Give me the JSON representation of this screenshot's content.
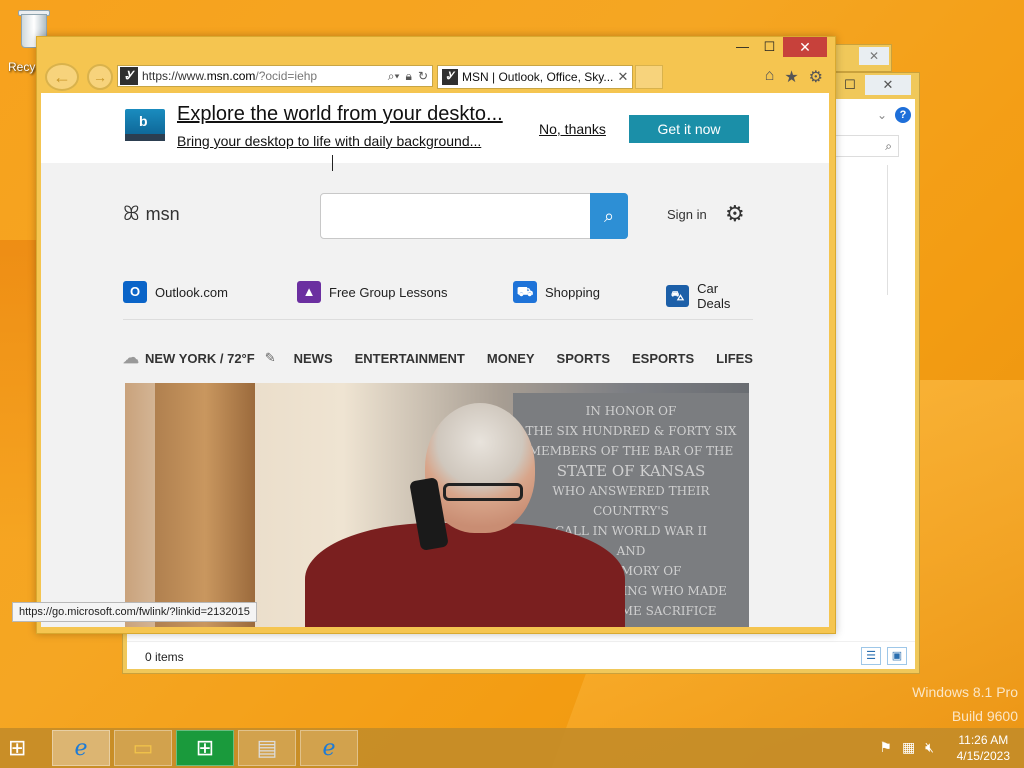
{
  "desktop": {
    "recycle_label": "Recyc",
    "watermark_line1": "Windows 8.1 Pro",
    "watermark_line2": "Build 9600"
  },
  "explorer": {
    "status_count": "0 items",
    "help_icon": "?",
    "search_icon": "search-icon"
  },
  "ie": {
    "window_buttons": {
      "minimize": "—",
      "maximize": "☐",
      "close": "✕"
    },
    "address": {
      "url_prefix": "https://www.",
      "url_domain": "msn.com",
      "url_suffix": "/?ocid=iehp"
    },
    "tab": {
      "title": "MSN | Outlook, Office, Sky...",
      "close": "✕"
    },
    "status_url": "https://go.microsoft.com/fwlink/?linkid=2132015"
  },
  "page": {
    "banner": {
      "headline": "Explore the world from your deskto...",
      "subtext": "Bring your desktop to life with daily background...",
      "no_thanks": "No, thanks",
      "get_it": "Get it now"
    },
    "logo_text": "msn",
    "sign_in": "Sign in",
    "quick_links": [
      {
        "label": "Outlook.com",
        "icon": "outlook-icon",
        "color": "#0a64c8"
      },
      {
        "label": "Free Group Lessons",
        "icon": "graduation-cap-icon",
        "color": "#6b2fa0"
      },
      {
        "label": "Shopping",
        "icon": "shopping-cart-icon",
        "color": "#1e73d8"
      },
      {
        "label": "Car Deals",
        "icon": "car-icon",
        "color": "#1c5fa8"
      }
    ],
    "weather": "NEW YORK / 72°F",
    "nav": [
      "NEWS",
      "ENTERTAINMENT",
      "MONEY",
      "SPORTS",
      "ESPORTS",
      "LIFESTY"
    ],
    "plaque_lines": [
      "IN HONOR OF",
      "THE SIX HUNDRED & FORTY SIX",
      "MEMBERS OF THE BAR OF THE",
      "STATE OF KANSAS",
      "WHO ANSWERED THEIR COUNTRY'S",
      "CALL IN WORLD WAR II",
      "AND",
      "IN MEMORY OF",
      "THE FOLLOWING WHO MADE",
      "THE SUPREME SACRIFICE"
    ]
  },
  "taskbar": {
    "time": "11:26 AM",
    "date": "4/15/2023"
  }
}
